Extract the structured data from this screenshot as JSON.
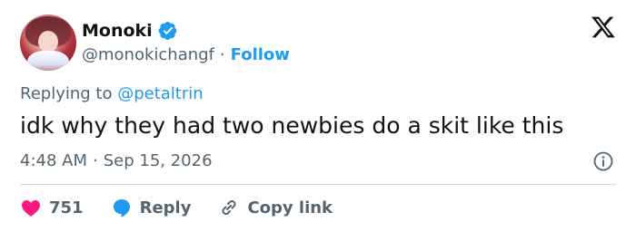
{
  "user": {
    "display_name": "Monoki",
    "handle": "@monokichangf",
    "separator": "·",
    "follow_label": "Follow"
  },
  "reply": {
    "prefix": "Replying to ",
    "mention": "@petaltrin"
  },
  "tweet": {
    "text": "idk why they had two newbies do a skit like this",
    "time": "4:48 AM",
    "separator": "·",
    "date": "Sep 15, 2026"
  },
  "actions": {
    "likes_count": "751",
    "reply_label": "Reply",
    "copy_link_label": "Copy link"
  },
  "colors": {
    "accent": "#1d9bf0",
    "like": "#f91880",
    "text": "#0f1419",
    "muted": "#536471"
  },
  "icons": [
    "verified-badge-icon",
    "x-logo-icon",
    "info-icon",
    "heart-icon",
    "reply-bubble-icon",
    "link-icon"
  ]
}
